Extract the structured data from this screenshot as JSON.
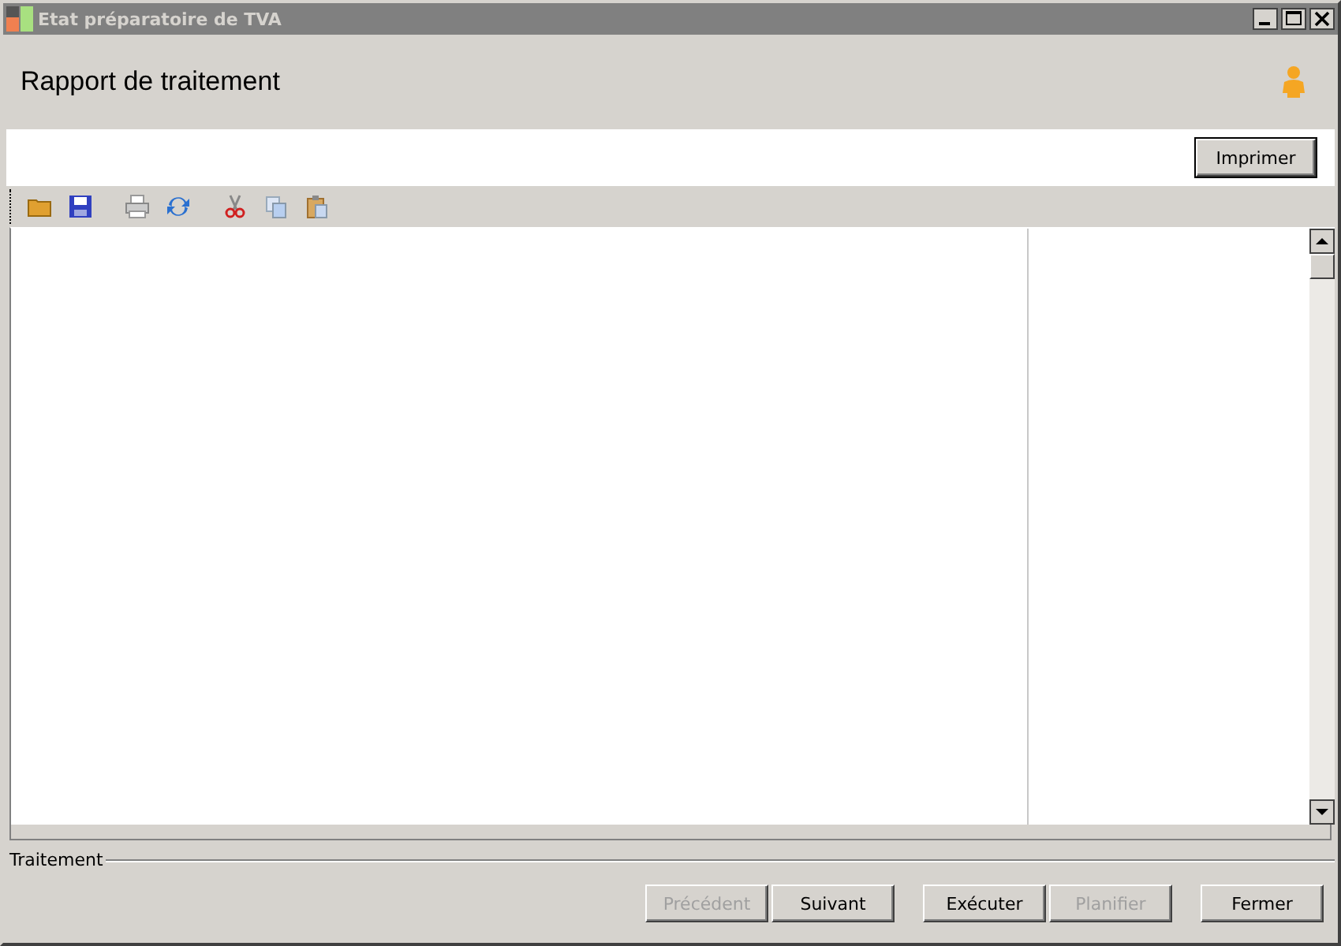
{
  "window": {
    "title": "Etat préparatoire de TVA"
  },
  "header": {
    "title": "Rapport de traitement"
  },
  "print_button": {
    "label": "Imprimer"
  },
  "group": {
    "label": "Traitement"
  },
  "buttons": [
    {
      "label": "Précédent",
      "disabled": true
    },
    {
      "label": "Suivant",
      "disabled": false
    },
    {
      "label": "Exécuter",
      "disabled": false
    },
    {
      "label": "Planifier",
      "disabled": true
    },
    {
      "label": "Fermer",
      "disabled": false
    }
  ]
}
